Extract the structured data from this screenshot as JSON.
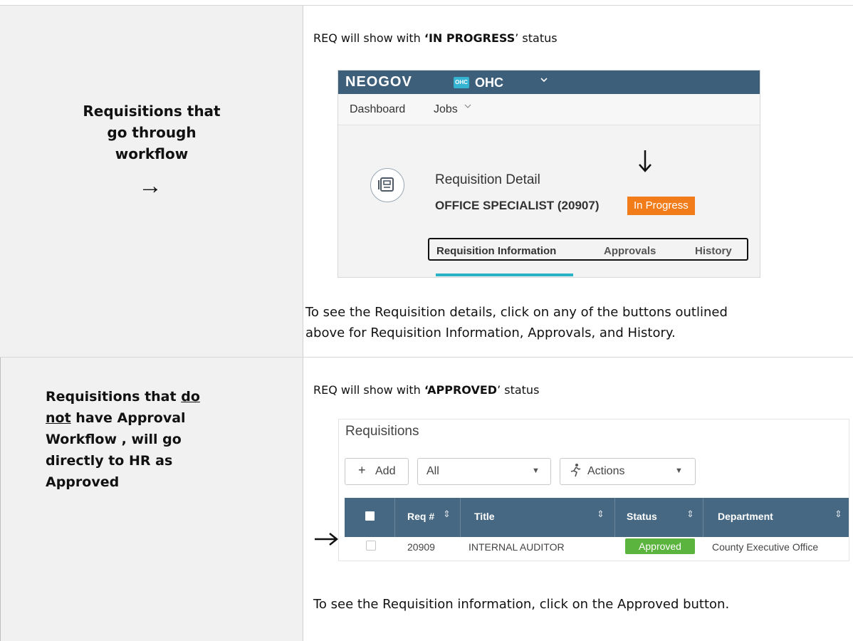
{
  "row1": {
    "left_lines": [
      "Requisitions that",
      "go through",
      "workflow"
    ],
    "left_arrow": "→",
    "status_prefix": "REQ will show with ",
    "status_value": "‘IN PROGRESS",
    "status_suffix": "’ status",
    "screenshot": {
      "logo": "NEOGOV",
      "org_badge": "OHC",
      "org_name": "OHC",
      "nav": [
        "Dashboard",
        "Jobs"
      ],
      "title": "Requisition Detail",
      "subtitle": "OFFICE SPECIALIST (20907)",
      "status_badge": "In Progress",
      "tabs": [
        "Requisition Information",
        "Approvals",
        "History"
      ],
      "colors": {
        "topbar": "#3e5f7a",
        "in_progress": "#f27c1a",
        "tab_underline": "#2ab3c6"
      }
    },
    "note_line1": "To see the Requisition details, click on any of the buttons outlined",
    "note_line2": "above for Requisition Information, Approvals, and History."
  },
  "row2": {
    "left_part1": "Requisitions that ",
    "left_underline1": "do",
    "left_underline2": "not",
    "left_part2": " have Approval",
    "left_line3": "Workflow , will go",
    "left_line4": "directly to HR as",
    "left_line5": "Approved",
    "status_prefix": "REQ will show with ",
    "status_value": "‘APPROVED",
    "status_suffix": "’ status",
    "screenshot": {
      "heading": "Requisitions",
      "add_label": "Add",
      "filter_value": "All",
      "actions_label": "Actions",
      "columns": [
        "Req #",
        "Title",
        "Status",
        "Department"
      ],
      "row": {
        "req": "20909",
        "title": "INTERNAL AUDITOR",
        "status": "Approved",
        "department": "County Executive Office"
      },
      "colors": {
        "header": "#466882",
        "approved": "#5bb43e"
      }
    },
    "note": "To see the Requisition information, click on the Approved button."
  }
}
